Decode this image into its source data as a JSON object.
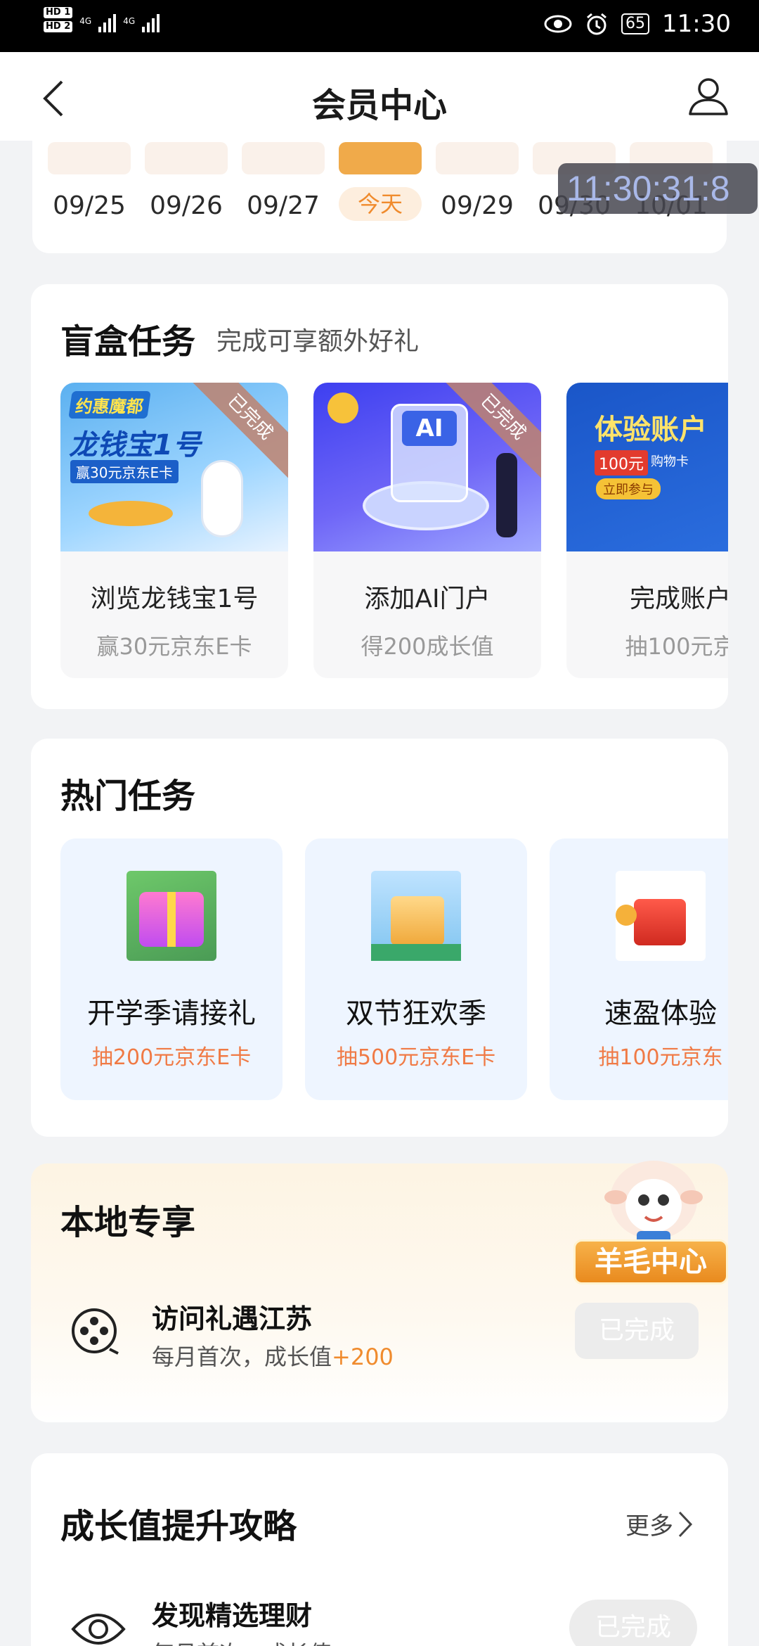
{
  "status": {
    "hd1": "HD 1",
    "hd2": "HD 2",
    "net1": "4G",
    "net2": "4G",
    "battery": "65",
    "time": "11:30"
  },
  "nav": {
    "title": "会员中心"
  },
  "calendar": {
    "dates": [
      "09/25",
      "09/26",
      "09/27",
      "今天",
      "09/29",
      "09/30",
      "10/01"
    ],
    "today_index": 3
  },
  "overlay_timer": "11:30:31:8",
  "blindbox": {
    "title": "盲盒任务",
    "subtitle": "完成可享额外好礼",
    "items": [
      {
        "name": "浏览龙钱宝1号",
        "desc": "赢30元京东E卡",
        "ribbon": "已完成",
        "img_text_1": "约惠魔都",
        "img_text_2": "龙钱宝1号",
        "img_text_3": "赢30元京东E卡"
      },
      {
        "name": "添加AI门户",
        "desc": "得200成长值",
        "ribbon": "已完成",
        "img_text_1": "AI"
      },
      {
        "name": "完成账户",
        "desc": "抽100元京",
        "img_text_1": "体验账户",
        "img_text_2": "100元",
        "img_text_3": "购物卡",
        "img_text_4": "立即参与"
      }
    ]
  },
  "hot": {
    "title": "热门任务",
    "items": [
      {
        "name": "开学季请接礼",
        "prize": "抽200元京东E卡"
      },
      {
        "name": "双节狂欢季",
        "prize": "抽500元京东E卡"
      },
      {
        "name": "速盈体验",
        "prize": "抽100元京东"
      }
    ]
  },
  "local": {
    "title": "本地专享",
    "mascot_label": "羊毛中心",
    "row": {
      "title": "访问礼遇江苏",
      "sub_prefix": "每月首次，成长值",
      "sub_value": "+200",
      "button": "已完成"
    }
  },
  "growth": {
    "title": "成长值提升攻略",
    "more": "更多",
    "row": {
      "title": "发现精选理财",
      "sub": "每月首次，成长值",
      "button": "已完成"
    }
  },
  "colors": {
    "accent": "#f08b2d",
    "today": "#f0aa4a",
    "prize": "#f07a45"
  }
}
